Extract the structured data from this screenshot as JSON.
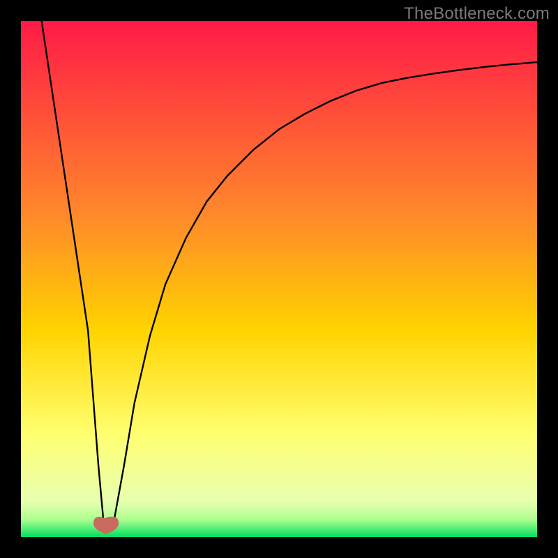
{
  "watermark": "TheBottleneck.com",
  "chart_data": {
    "type": "line",
    "title": "",
    "xlabel": "",
    "ylabel": "",
    "xlim": [
      0,
      100
    ],
    "ylim": [
      0,
      100
    ],
    "grid": false,
    "legend": false,
    "series": [
      {
        "name": "curve",
        "x": [
          4,
          7,
          10,
          13,
          14,
          15,
          16,
          17,
          18,
          20,
          22,
          25,
          28,
          32,
          36,
          40,
          45,
          50,
          55,
          60,
          65,
          70,
          75,
          80,
          85,
          90,
          95,
          100
        ],
        "values": [
          100,
          80,
          60,
          40,
          27,
          14,
          3,
          3,
          3,
          14,
          26,
          39,
          49,
          58,
          65,
          70,
          75,
          79,
          82,
          84.5,
          86.5,
          88,
          89,
          89.8,
          90.5,
          91.1,
          91.6,
          92
        ]
      },
      {
        "name": "green-band",
        "x": [
          0,
          100
        ],
        "values": [
          0,
          0
        ]
      }
    ],
    "marker": {
      "x": 16.5,
      "y": 3
    },
    "colors": {
      "gradient_top": "#ff1a47",
      "gradient_mid": "#ffd400",
      "gradient_low": "#ffff70",
      "gradient_bottom": "#00e060",
      "curve": "#000000",
      "marker": "#c96a5f",
      "frame": "#000000"
    }
  }
}
